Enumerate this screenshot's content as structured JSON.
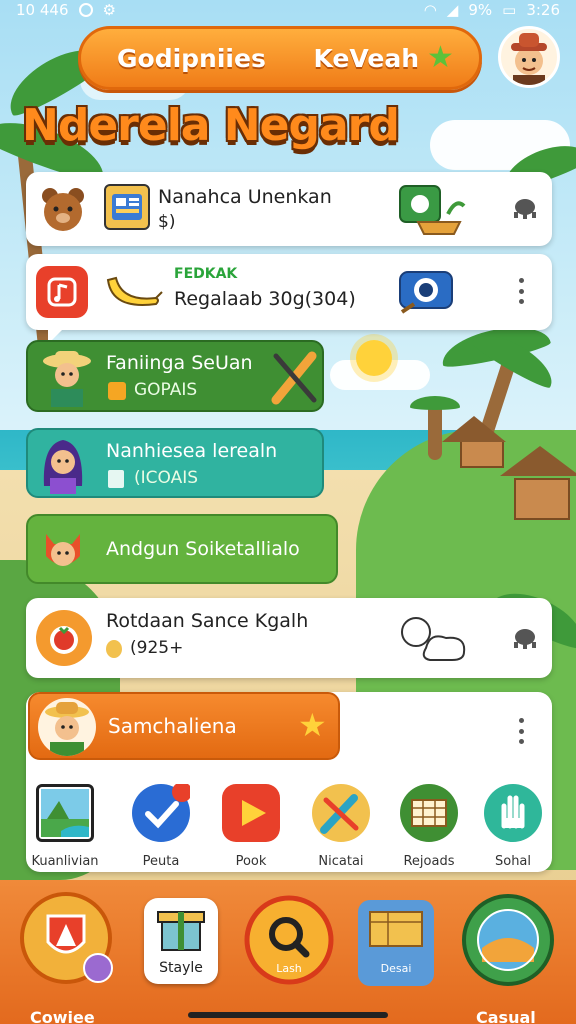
{
  "status": {
    "time_left": "10 446",
    "battery": "9%",
    "clock": "3:26"
  },
  "header": {
    "left_label": "Godipniies",
    "right_label": "KeVeah"
  },
  "page_title": "Nderela Negard",
  "cards": [
    {
      "title": "Nanahca Unenkan",
      "subtitle": "$)"
    },
    {
      "tag": "FEDKAK",
      "title": "Regalaab 30g(304)"
    },
    {
      "title": "Faniinga SeUan",
      "subtitle": "GOPAIS"
    },
    {
      "title": "Nanhiesea lerealn",
      "subtitle": "(ICOAIS"
    },
    {
      "title": "Andgun Soiketallialo"
    },
    {
      "title": "Rotdaan Sance Kgalh",
      "subtitle": "(925+"
    }
  ],
  "banner": {
    "title": "Samchaliena"
  },
  "apps": [
    {
      "label": "Kuanlivian",
      "icon": "landscape-icon"
    },
    {
      "label": "Peuta",
      "icon": "checkmark-icon"
    },
    {
      "label": "Pook",
      "icon": "play-icon"
    },
    {
      "label": "Nicatai",
      "icon": "pen-tool-icon"
    },
    {
      "label": "Rejoads",
      "icon": "calendar-icon"
    },
    {
      "label": "Sohal",
      "icon": "hand-icon"
    }
  ],
  "dock": [
    {
      "label": "",
      "icon": "shield-badge-icon"
    },
    {
      "label": "Stayle",
      "icon": "gift-box-icon"
    },
    {
      "label": "Lash",
      "icon": "search-icon"
    },
    {
      "label": "Desai",
      "icon": "board-icon"
    },
    {
      "label": "",
      "icon": "globe-seal-icon"
    }
  ],
  "corners": {
    "left": "Cowiee",
    "right": "Casual"
  },
  "colors": {
    "orange": "#f07c18",
    "green": "#3f8f33",
    "teal": "#30b3a0",
    "leaf": "#64b33e"
  }
}
